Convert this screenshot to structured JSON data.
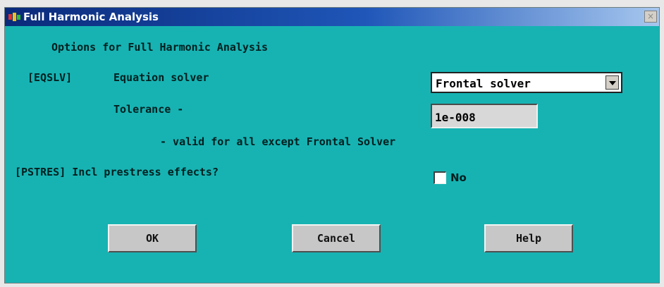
{
  "window": {
    "title": "Full Harmonic Analysis",
    "close_label": "×"
  },
  "heading": "Options for Full Harmonic Analysis",
  "eqslv": {
    "tag": "[EQSLV]",
    "label": "Equation solver",
    "selected": "Frontal solver"
  },
  "tolerance": {
    "label": "Tolerance -",
    "value": "1e-008",
    "note": "- valid for all except Frontal Solver"
  },
  "pstres": {
    "label": "[PSTRES] Incl prestress effects?",
    "checked": false,
    "state_label": "No"
  },
  "buttons": {
    "ok": "OK",
    "cancel": "Cancel",
    "help": "Help"
  },
  "colors": {
    "dialog_background": "#17b3b3",
    "titlebar_start": "#0a2a7a",
    "titlebar_end": "#a6c7ee",
    "button_face": "#c7c7c7"
  },
  "icons": {
    "title": "ansys-logo-icon",
    "close": "close-icon",
    "dropdown": "chevron-down-icon"
  }
}
